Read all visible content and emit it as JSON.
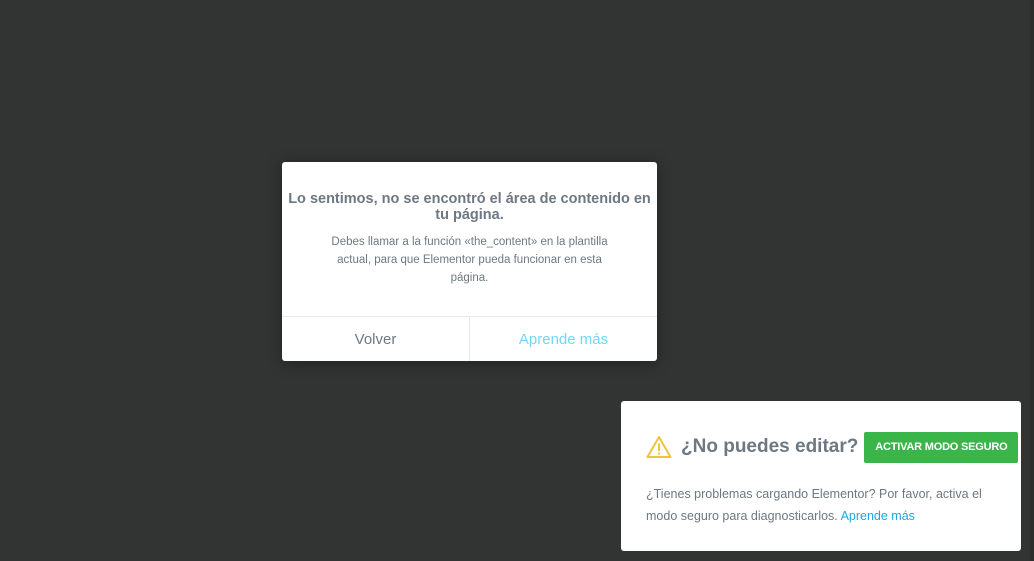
{
  "dialog": {
    "title": "Lo sentimos, no se encontró el área de contenido en tu página.",
    "message": "Debes llamar a la función «the_content» en la plantilla actual, para que Elementor pueda funcionar en esta página.",
    "cancel_label": "Volver",
    "confirm_label": "Aprende más"
  },
  "safe_mode": {
    "icon": "warning-icon",
    "title": "¿No puedes editar?",
    "button_label": "ACTIVAR MODO SEGURO",
    "text": "¿Tienes problemas cargando Elementor? Por favor, activa el modo seguro para diagnosticarlos.",
    "link_label": "Aprende más"
  },
  "colors": {
    "background": "#323433",
    "text": "#6d7882",
    "accent_light_blue": "#71d7f7",
    "button_green": "#39b54a",
    "link_blue": "#1da7e0",
    "warning_yellow": "#f0c33c"
  }
}
